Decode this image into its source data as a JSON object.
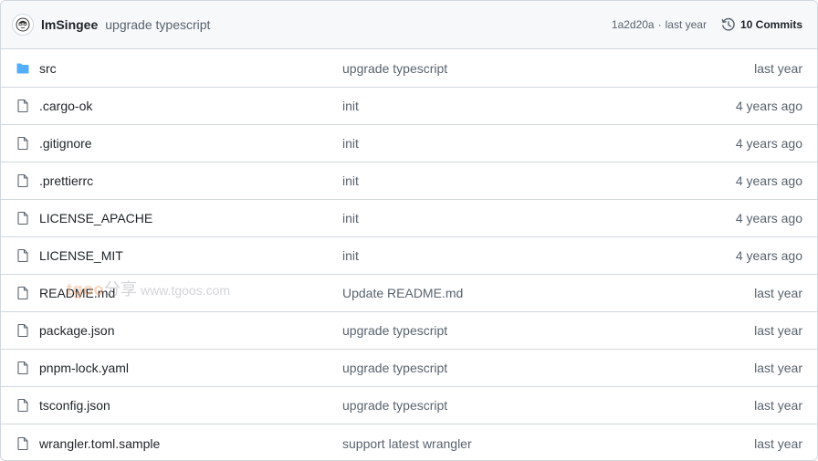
{
  "header": {
    "author": "lmSingee",
    "commit_message": "upgrade typescript",
    "commit_hash": "1a2d20a",
    "commit_age": "last year",
    "commits_label": "10 Commits"
  },
  "files": [
    {
      "name": "src",
      "type": "folder",
      "message": "upgrade typescript",
      "age": "last year"
    },
    {
      "name": ".cargo-ok",
      "type": "file",
      "message": "init",
      "age": "4 years ago"
    },
    {
      "name": ".gitignore",
      "type": "file",
      "message": "init",
      "age": "4 years ago"
    },
    {
      "name": ".prettierrc",
      "type": "file",
      "message": "init",
      "age": "4 years ago"
    },
    {
      "name": "LICENSE_APACHE",
      "type": "file",
      "message": "init",
      "age": "4 years ago"
    },
    {
      "name": "LICENSE_MIT",
      "type": "file",
      "message": "init",
      "age": "4 years ago"
    },
    {
      "name": "README.md",
      "type": "file",
      "message": "Update README.md",
      "age": "last year"
    },
    {
      "name": "package.json",
      "type": "file",
      "message": "upgrade typescript",
      "age": "last year"
    },
    {
      "name": "pnpm-lock.yaml",
      "type": "file",
      "message": "upgrade typescript",
      "age": "last year"
    },
    {
      "name": "tsconfig.json",
      "type": "file",
      "message": "upgrade typescript",
      "age": "last year"
    },
    {
      "name": "wrangler.toml.sample",
      "type": "file",
      "message": "support latest wrangler",
      "age": "last year"
    }
  ],
  "watermark": {
    "logo": "tgoo",
    "cn": "分享",
    "url": "www.tgoos.com"
  },
  "colors": {
    "folder": "#54aeff",
    "file_icon": "#59636e",
    "border": "#d0d7de",
    "header_bg": "#f6f8fa"
  },
  "icons": {
    "folder": "folder-icon",
    "file": "file-icon",
    "history": "history-icon",
    "avatar": "avatar-icon"
  }
}
